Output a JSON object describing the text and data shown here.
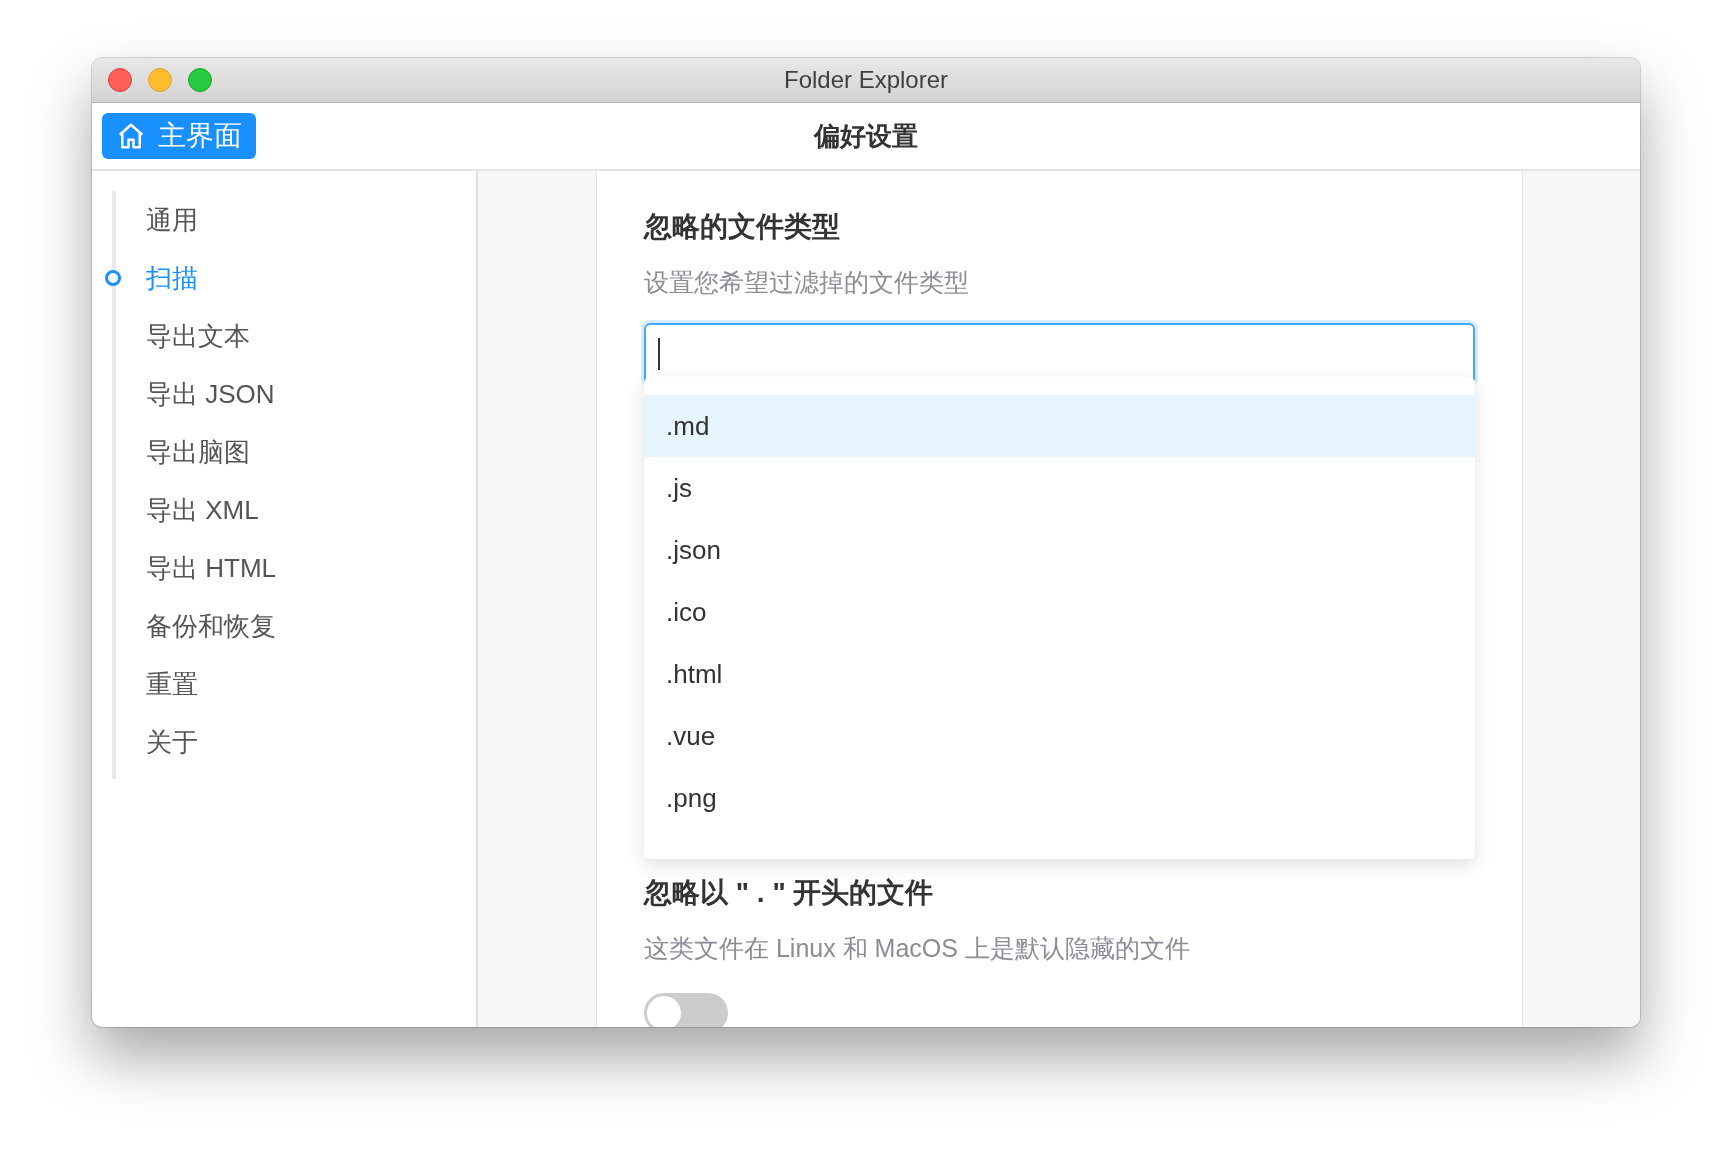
{
  "window": {
    "title": "Folder Explorer"
  },
  "header": {
    "home_button": "主界面",
    "title": "偏好设置"
  },
  "sidebar": {
    "items": [
      {
        "label": "通用",
        "selected": false
      },
      {
        "label": "扫描",
        "selected": true
      },
      {
        "label": "导出文本",
        "selected": false
      },
      {
        "label": "导出 JSON",
        "selected": false
      },
      {
        "label": "导出脑图",
        "selected": false
      },
      {
        "label": "导出 XML",
        "selected": false
      },
      {
        "label": "导出 HTML",
        "selected": false
      },
      {
        "label": "备份和恢复",
        "selected": false
      },
      {
        "label": "重置",
        "selected": false
      },
      {
        "label": "关于",
        "selected": false
      }
    ]
  },
  "file_types": {
    "title": "忽略的文件类型",
    "description": "设置您希望过滤掉的文件类型",
    "input": {
      "focused": true
    },
    "dropdown": [
      {
        "label": ".md",
        "selected": true
      },
      {
        "label": ".js",
        "selected": false
      },
      {
        "label": ".json",
        "selected": false
      },
      {
        "label": ".ico",
        "selected": false
      },
      {
        "label": ".html",
        "selected": false
      },
      {
        "label": ".vue",
        "selected": false
      },
      {
        "label": ".png",
        "selected": false
      }
    ]
  },
  "hidden_files": {
    "title": "忽略以 \" . \" 开头的文件",
    "description": "这类文件在 Linux 和 MacOS 上是默认隐藏的文件",
    "toggle": {
      "on": false
    }
  }
}
